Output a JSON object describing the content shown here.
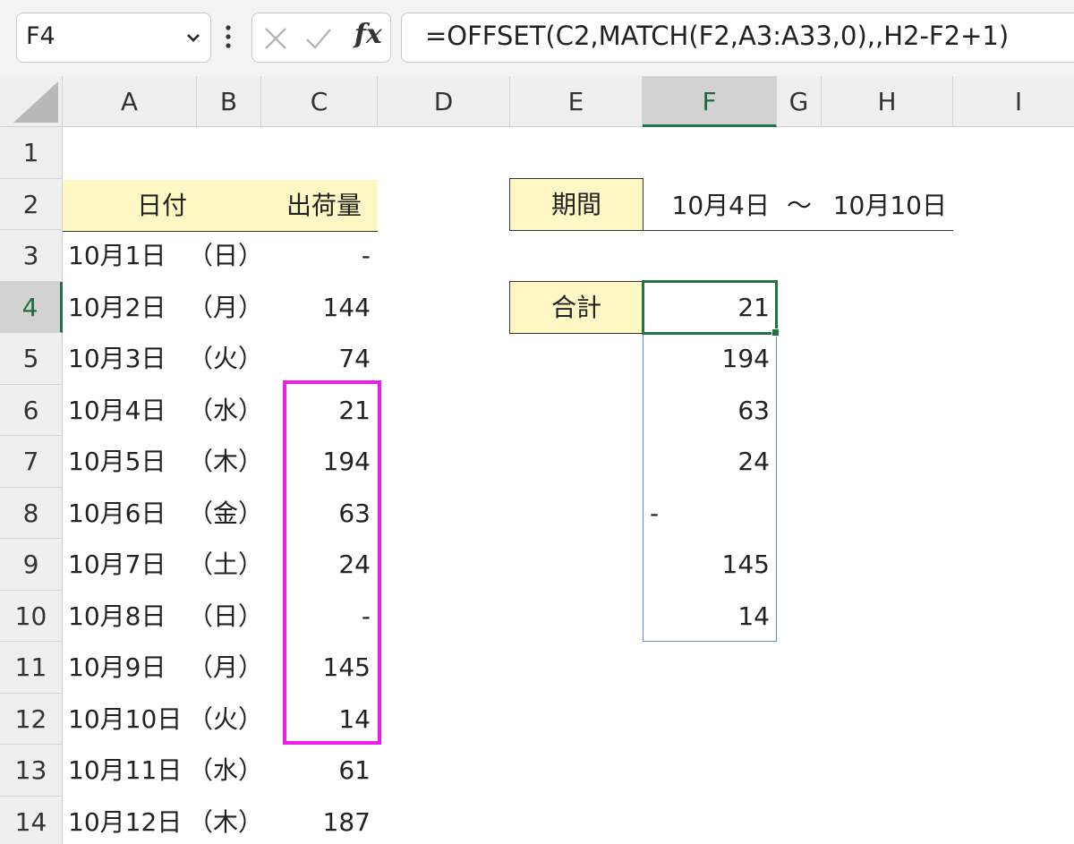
{
  "name_box": "F4",
  "formula": "=OFFSET(C2,MATCH(F2,A3:A33,0),,H2-F2+1)",
  "icons": {
    "dropdown": "chevron-down-icon",
    "more": "vertical-dots-icon",
    "cancel": "x-icon",
    "enter": "check-icon",
    "function": "fx-icon"
  },
  "fx_label": "fx",
  "columns": [
    "A",
    "B",
    "C",
    "D",
    "E",
    "F",
    "G",
    "H",
    "I"
  ],
  "rows": [
    "1",
    "2",
    "3",
    "4",
    "5",
    "6",
    "7",
    "8",
    "9",
    "10",
    "11",
    "12",
    "13",
    "14"
  ],
  "selected_column": "F",
  "selected_row": "4",
  "colors": {
    "header_fill": "#fff8c4",
    "highlight_border": "#ee1ce8",
    "active_border": "#217346",
    "spill_border": "#5b8fd6"
  },
  "table": {
    "header_date": "日付",
    "header_qty": "出荷量",
    "rows": [
      {
        "date": "10月1日",
        "day": "（日）",
        "qty": "-"
      },
      {
        "date": "10月2日",
        "day": "（月）",
        "qty": "144"
      },
      {
        "date": "10月3日",
        "day": "（火）",
        "qty": "74"
      },
      {
        "date": "10月4日",
        "day": "（水）",
        "qty": "21"
      },
      {
        "date": "10月5日",
        "day": "（木）",
        "qty": "194"
      },
      {
        "date": "10月6日",
        "day": "（金）",
        "qty": "63"
      },
      {
        "date": "10月7日",
        "day": "（土）",
        "qty": "24"
      },
      {
        "date": "10月8日",
        "day": "（日）",
        "qty": "-"
      },
      {
        "date": "10月9日",
        "day": "（月）",
        "qty": "145"
      },
      {
        "date": "10月10日",
        "day": "（火）",
        "qty": "14"
      },
      {
        "date": "10月11日",
        "day": "（水）",
        "qty": "61"
      },
      {
        "date": "10月12日",
        "day": "（木）",
        "qty": "187"
      }
    ]
  },
  "period": {
    "label": "期間",
    "start": "10月4日",
    "sep": "〜",
    "end": "10月10日"
  },
  "total": {
    "label": "合計",
    "values": [
      "21",
      "194",
      "63",
      "24",
      "-",
      "145",
      "14"
    ]
  }
}
